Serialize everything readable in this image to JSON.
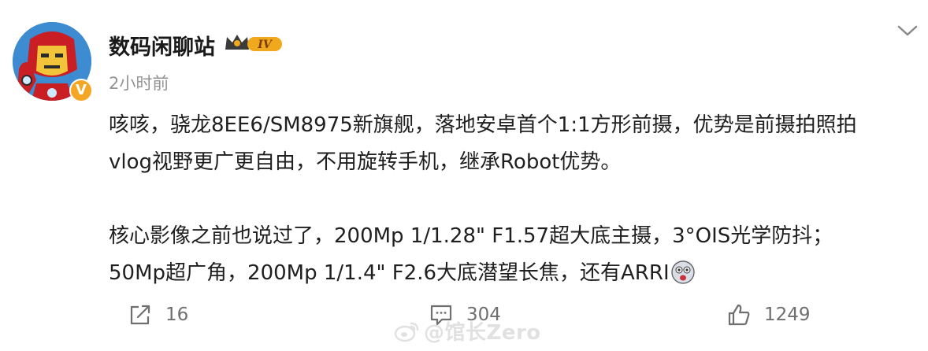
{
  "user": {
    "name": "数码闲聊站",
    "level_badge": "IV",
    "verified_mark": "V",
    "time": "2小时前"
  },
  "post": {
    "lines": [
      "咳咳，骁龙8EE6/SM8975新旗舰，落地安卓首个1:1方形前摄，优势是前摄拍照拍",
      "vlog视野更广更自由，不用旋转手机，继承Robot优势。",
      "核心影像之前也说过了，200Mp 1/1.28\" F1.57超大底主摄，3°OIS光学防抖；",
      "50Mp超广角，200Mp 1/1.4\" F2.6大底潜望长焦，还有ARRI"
    ]
  },
  "actions": {
    "repost_count": "16",
    "comment_count": "304",
    "like_count": "1249"
  },
  "watermark": {
    "text": "@馆长Zero"
  },
  "icons": [
    "avatar-ironman",
    "crown-badge-icon",
    "chevron-down-icon",
    "emoji-face-icon",
    "repost-icon",
    "comment-icon",
    "like-icon",
    "weibo-logo-icon"
  ],
  "colors": {
    "text": "#1f1f1f",
    "muted": "#939393",
    "verified": "#f5a623",
    "crown": "#f0a81c"
  }
}
